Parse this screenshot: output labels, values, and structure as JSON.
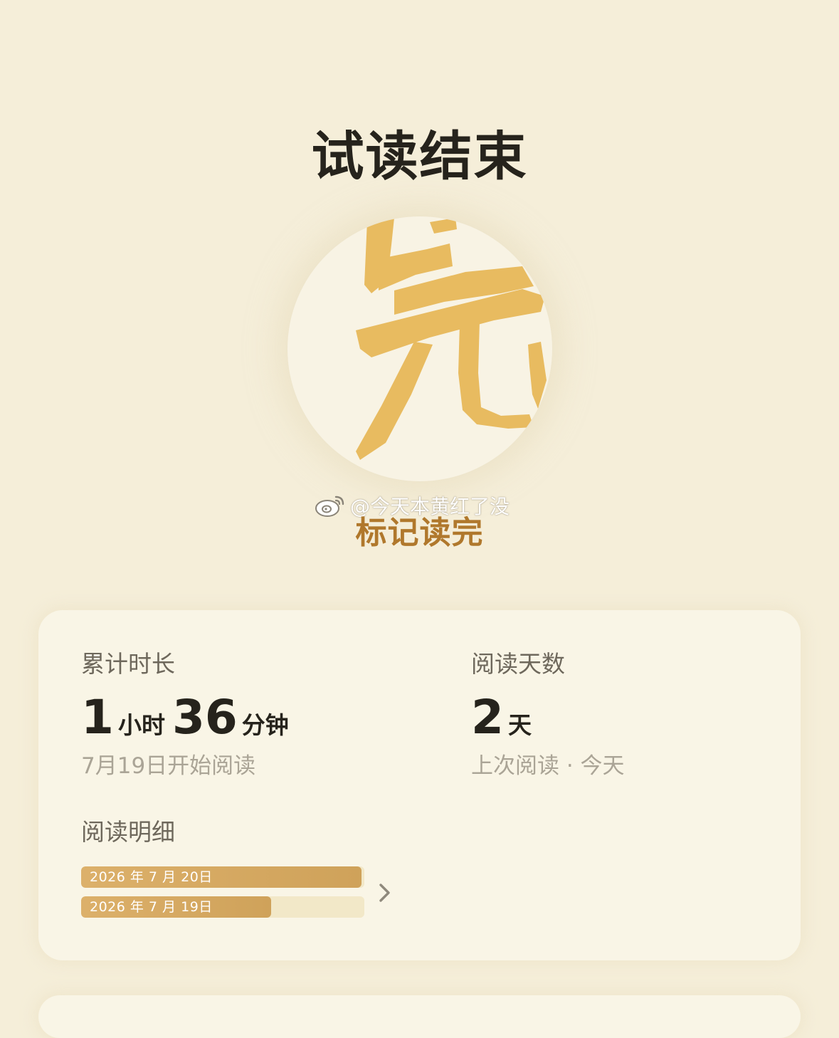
{
  "header": {
    "title": "试读结束"
  },
  "emblem": {
    "glyph": "完",
    "color": "#e8bb60"
  },
  "watermark": {
    "icon": "weibo-icon",
    "text": "@今天本黄红了没"
  },
  "mark_finished_label": "标记读完",
  "stats": {
    "total_time": {
      "label": "累计时长",
      "hours": "1",
      "hours_unit": "小时",
      "minutes": "36",
      "minutes_unit": "分钟",
      "since": "7月19日开始阅读"
    },
    "days": {
      "label": "阅读天数",
      "value": "2",
      "unit": "天",
      "last_read": "上次阅读 · 今天"
    },
    "detail": {
      "label": "阅读明细",
      "rows": [
        {
          "date": "2026 年 7 月 20日",
          "fraction": 0.99
        },
        {
          "date": "2026 年 7 月 19日",
          "fraction": 0.67
        }
      ],
      "chevron_icon": "chevron-right-icon"
    }
  },
  "colors": {
    "background": "#f5eed9",
    "accent": "#b0782c",
    "bar_fill": "#d6a860",
    "bar_track": "#f2e8c8"
  }
}
